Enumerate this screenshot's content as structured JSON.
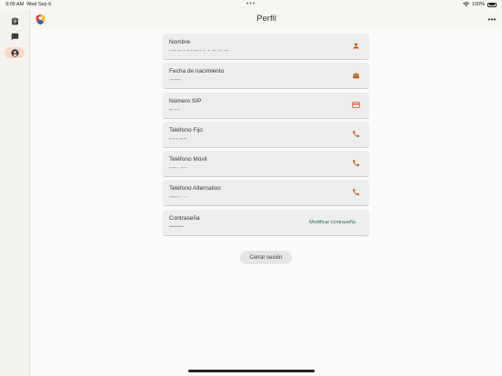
{
  "status_bar": {
    "time": "9:09 AM",
    "date": "Wed Sep 6",
    "battery": "100%"
  },
  "header": {
    "title": "Perfil"
  },
  "sidebar": {
    "items": [
      {
        "icon": "clipboard-icon",
        "active": false
      },
      {
        "icon": "chat-icon",
        "active": false
      },
      {
        "icon": "account-icon",
        "active": true
      }
    ]
  },
  "profile": {
    "fields": [
      {
        "label": "Nombre",
        "value": "▪▫▪▪ ▪▫▫▪ ▪▫▪▫▪▪▫▪ ▪▫ ▪ ▫▪▪ ▫▪ ▫▪▪",
        "icon": "person-icon"
      },
      {
        "label": "Fecha de nacimiento",
        "value": "▫▪▫▪▪▪▫",
        "icon": "cake-icon"
      },
      {
        "label": "Número SIP",
        "value": "▪▪▫▪▫▪",
        "icon": "credit-card-icon"
      },
      {
        "label": "Teléfono Fijo",
        "value": "▪▫▪▫▪ ▪▫▪▪",
        "icon": "phone-icon"
      },
      {
        "label": "Teléfono Móvil",
        "value": "▪▫▪▪ ▫ ▪▫▪",
        "icon": "phone-icon"
      },
      {
        "label": "Teléfono Alternativo",
        "value": "▫▪▪▪▫▪ ▫ ▪",
        "icon": "phone-icon"
      },
      {
        "label": "Contraseña",
        "value": "••••••••••",
        "action": "Modificar contraseña"
      }
    ],
    "logout_label": "Cerrar sesión"
  },
  "colors": {
    "accent": "#c1561f",
    "link": "#2f6b55",
    "active_nav_bg": "#f6d9c8"
  }
}
